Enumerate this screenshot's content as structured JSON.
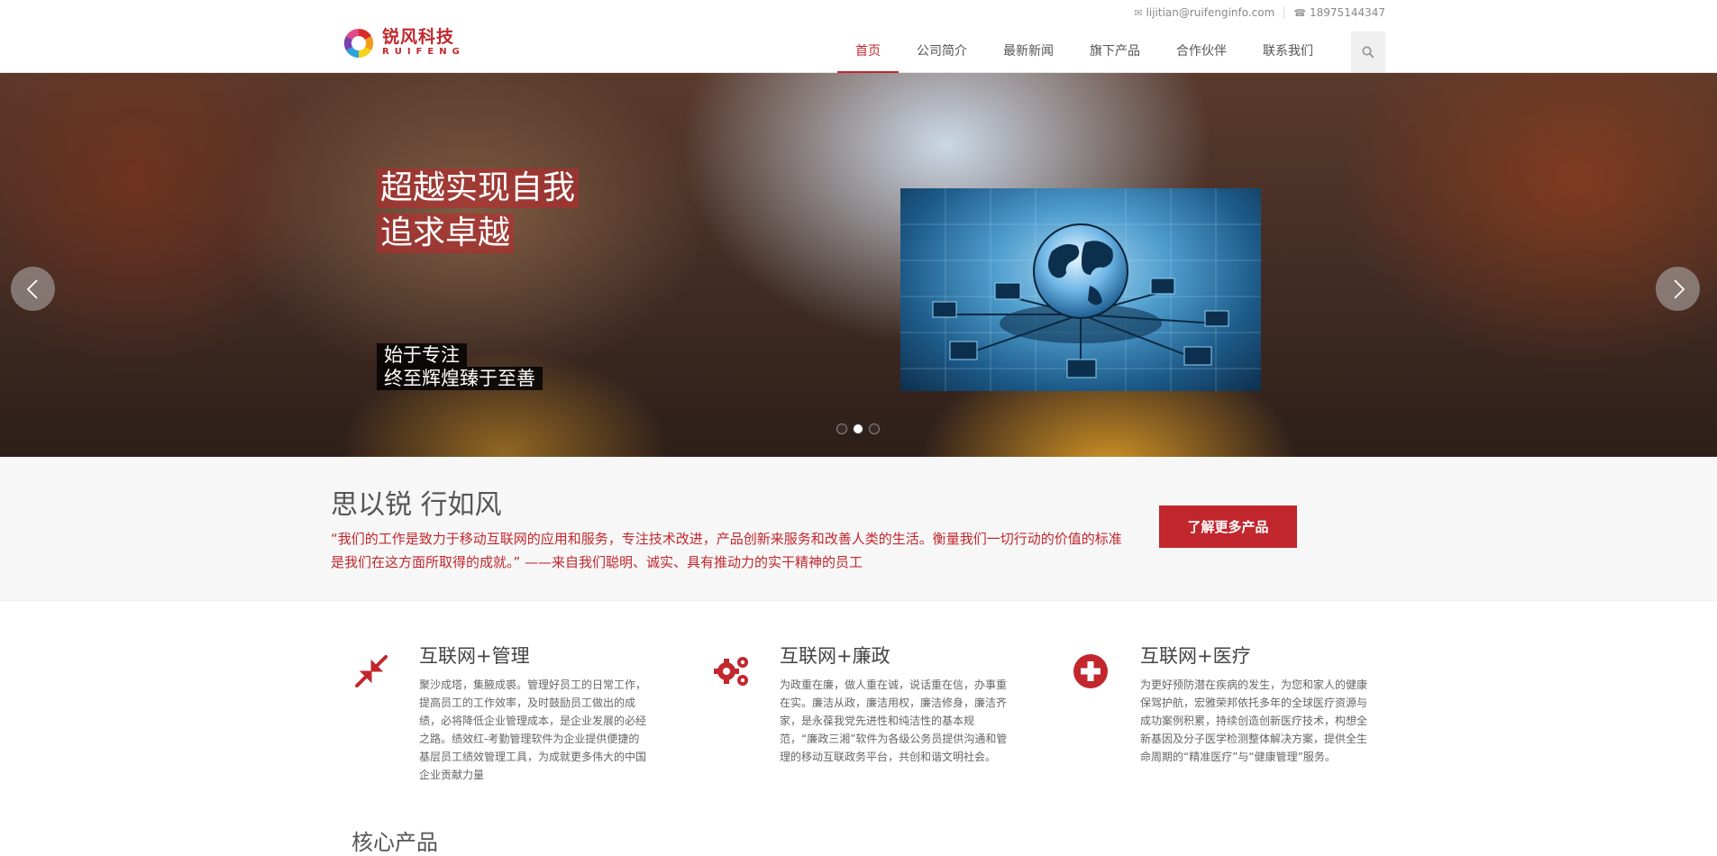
{
  "header": {
    "logo": {
      "cn": "锐风科技",
      "en": "RUIFENG"
    },
    "email": "lijitian@ruifenginfo.com",
    "phone": "18975144347",
    "nav": [
      {
        "label": "首页",
        "active": true
      },
      {
        "label": "公司简介",
        "active": false
      },
      {
        "label": "最新新闻",
        "active": false
      },
      {
        "label": "旗下产品",
        "active": false
      },
      {
        "label": "合作伙伴",
        "active": false
      },
      {
        "label": "联系我们",
        "active": false
      }
    ],
    "search_icon": "search-icon"
  },
  "hero": {
    "title_line1": "超越实现自我",
    "title_line2": "追求卓越",
    "sub_line1": "始于专注",
    "sub_line2": "终至辉煌臻于至善",
    "slide_count": 3,
    "active_slide": 2
  },
  "slogan": {
    "title": "思以锐 行如风",
    "quote": "“我们的工作是致力于移动互联网的应用和服务，专注技术改进，产品创新来服务和改善人类的生活。衡量我们一切行动的价值的标准是我们在这方面所取得的成就。” ——来自我们聪明、诚实、具有推动力的实干精神的员工",
    "button": "了解更多产品"
  },
  "features": [
    {
      "icon": "compress-arrows-icon",
      "title": "互联网+管理",
      "text": "聚沙成塔，集腋成裘。管理好员工的日常工作，提高员工的工作效率，及时鼓励员工做出的成绩，必将降低企业管理成本，是企业发展的必经之路。绩效红-考勤管理软件为企业提供便捷的基层员工绩效管理工具，为成就更多伟大的中国企业贡献力量"
    },
    {
      "icon": "gears-icon",
      "title": "互联网+廉政",
      "text": "为政重在廉，做人重在诚，说话重在信，办事重在实。廉洁从政，廉洁用权，廉洁修身，廉洁齐家，是永葆我党先进性和纯洁性的基本规范，“廉政三湘”软件为各级公务员提供沟通和管理的移动互联政务平台，共创和谐文明社会。"
    },
    {
      "icon": "medical-cross-icon",
      "title": "互联网+医疗",
      "text": "为更好预防潜在疾病的发生，为您和家人的健康保驾护航，宏雅荣邦依托多年的全球医疗资源与成功案例积累，持续创造创新医疗技术，构想全新基因及分子医学检测整体解决方案，提供全生命周期的“精准医疗”与“健康管理”服务。"
    }
  ],
  "core_title": "核心产品",
  "colors": {
    "brand": "#c1272d"
  }
}
